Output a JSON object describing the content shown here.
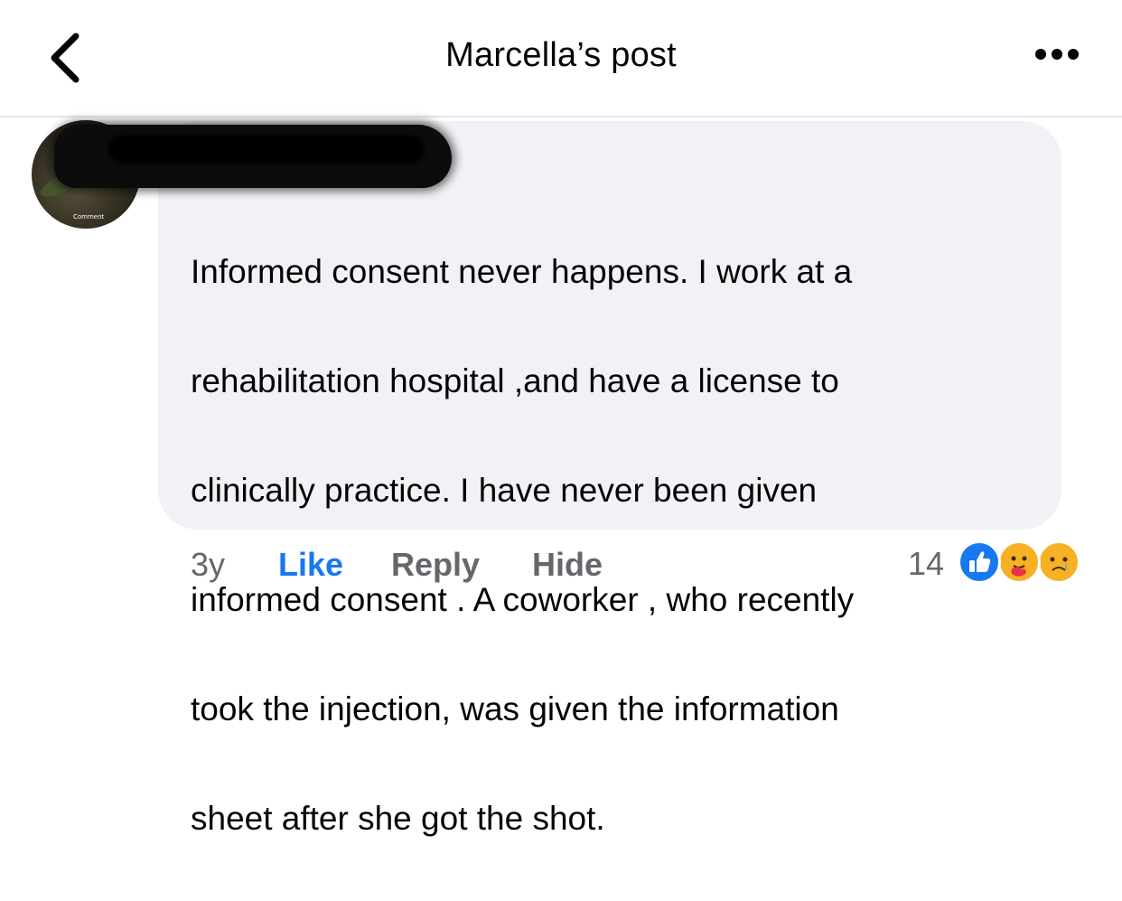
{
  "header": {
    "title": "Marcella’s post",
    "back_icon": "chevron-left-icon",
    "more_icon": "more-horizontal-icon"
  },
  "comment": {
    "avatar_stamp": "Comment",
    "text_lines": [
      "Informed consent never happens. I work at a",
      "rehabilitation hospital ,and have a license to",
      "clinically practice. I have never been given",
      "informed consent . A coworker , who recently",
      "took the injection, was given the information",
      "sheet after she got the shot."
    ],
    "age": "3y",
    "like_label": "Like",
    "reply_label": "Reply",
    "hide_label": "Hide",
    "reaction_count": "14",
    "reactions": [
      "like-reaction-icon",
      "care-reaction-icon",
      "sad-reaction-icon"
    ]
  },
  "colors": {
    "accent": "#1877f2",
    "bubble": "#f0f2f5",
    "secondary_text": "#65676b",
    "reaction_yellow": "#f7b125"
  }
}
